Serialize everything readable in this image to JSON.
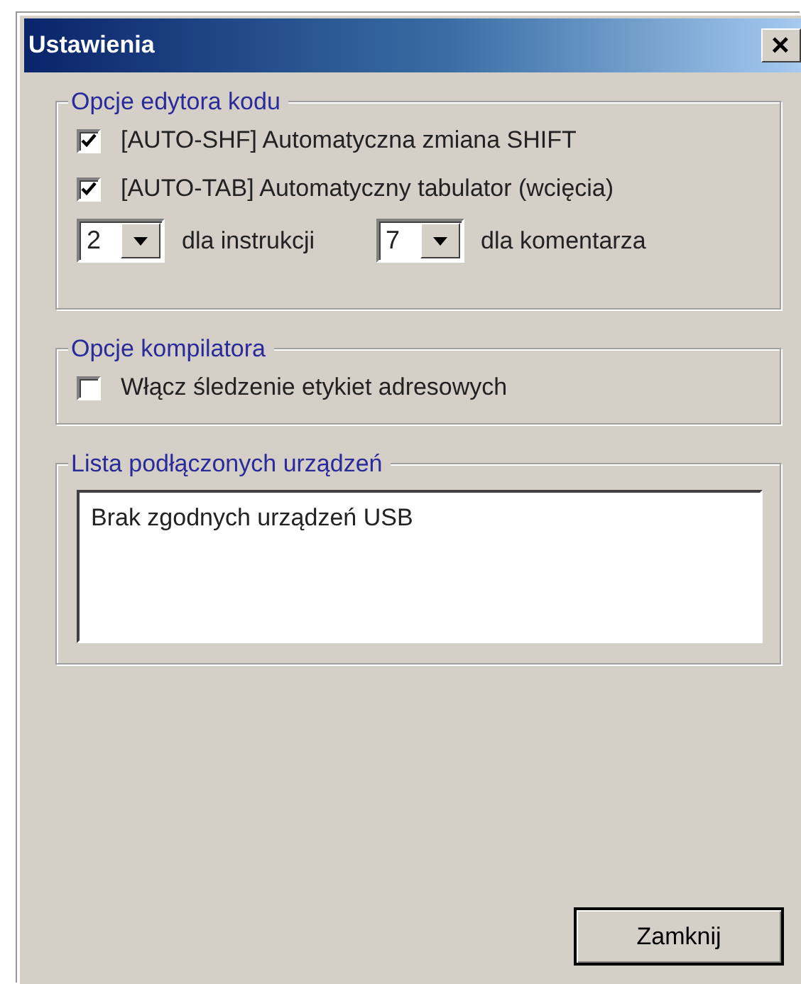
{
  "window": {
    "title": "Ustawienia",
    "close": "×"
  },
  "editor_group": {
    "title": "Opcje edytora kodu",
    "checkboxes": [
      {
        "label": "[AUTO-SHF] Automatyczna zmiana SHIFT",
        "checked": true
      },
      {
        "label": "[AUTO-TAB] Automatyczny tabulator (wcięcia)",
        "checked": true
      }
    ],
    "indents": [
      {
        "value": "2",
        "suffix": "dla instrukcji"
      },
      {
        "value": "7",
        "suffix": "dla komentarza"
      }
    ]
  },
  "compiler_group": {
    "title": "Opcje kompilatora",
    "checkboxes": [
      {
        "label": "Włącz śledzenie etykiet adresowych",
        "checked": false
      }
    ]
  },
  "devices_group": {
    "title": "Lista podłączonych urządzeń",
    "items": [
      "Brak zgodnych urządzeń USB"
    ]
  },
  "buttons": [
    "Zamknij"
  ]
}
